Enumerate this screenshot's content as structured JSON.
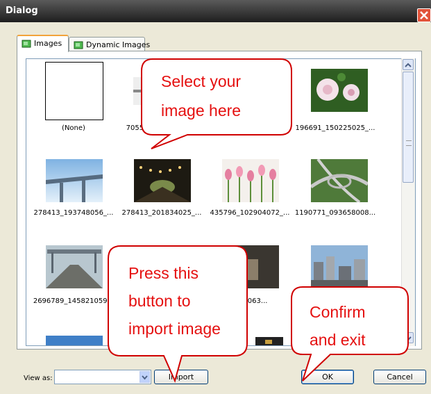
{
  "window": {
    "title": "Dialog"
  },
  "tabs": [
    {
      "label": "Images",
      "active": true
    },
    {
      "label": "Dynamic Images",
      "active": false
    }
  ],
  "images": [
    {
      "caption": "(None)",
      "kind": "none"
    },
    {
      "caption": "70557_0...",
      "kind": "photo"
    },
    {
      "caption": "...",
      "kind": "photo"
    },
    {
      "caption": "196691_150225025_...",
      "kind": "flower"
    },
    {
      "caption": "278413_193748056_...",
      "kind": "bridge"
    },
    {
      "caption": "278413_201834025_...",
      "kind": "tunnel"
    },
    {
      "caption": "435796_102904072_...",
      "kind": "tulips"
    },
    {
      "caption": "1190771_093658008...",
      "kind": "highway"
    },
    {
      "caption": "2696789_145821059...",
      "kind": "rail"
    },
    {
      "caption": "...",
      "kind": "photo"
    },
    {
      "caption": "...57063...",
      "kind": "photo"
    },
    {
      "caption": "...",
      "kind": "city"
    }
  ],
  "bottom": {
    "view_as_label": "View as:",
    "view_as_value": "",
    "import_label": "Import",
    "ok_label": "OK",
    "cancel_label": "Cancel"
  },
  "callouts": {
    "select": [
      "Select   your",
      "image here"
    ],
    "press": [
      "Press          this",
      "button          to",
      "import image"
    ],
    "confirm": [
      "Confirm",
      "and exit"
    ]
  },
  "colors": {
    "callout_text": "#e51010",
    "callout_border": "#d00000",
    "tab_accent": "#f2a33a"
  }
}
